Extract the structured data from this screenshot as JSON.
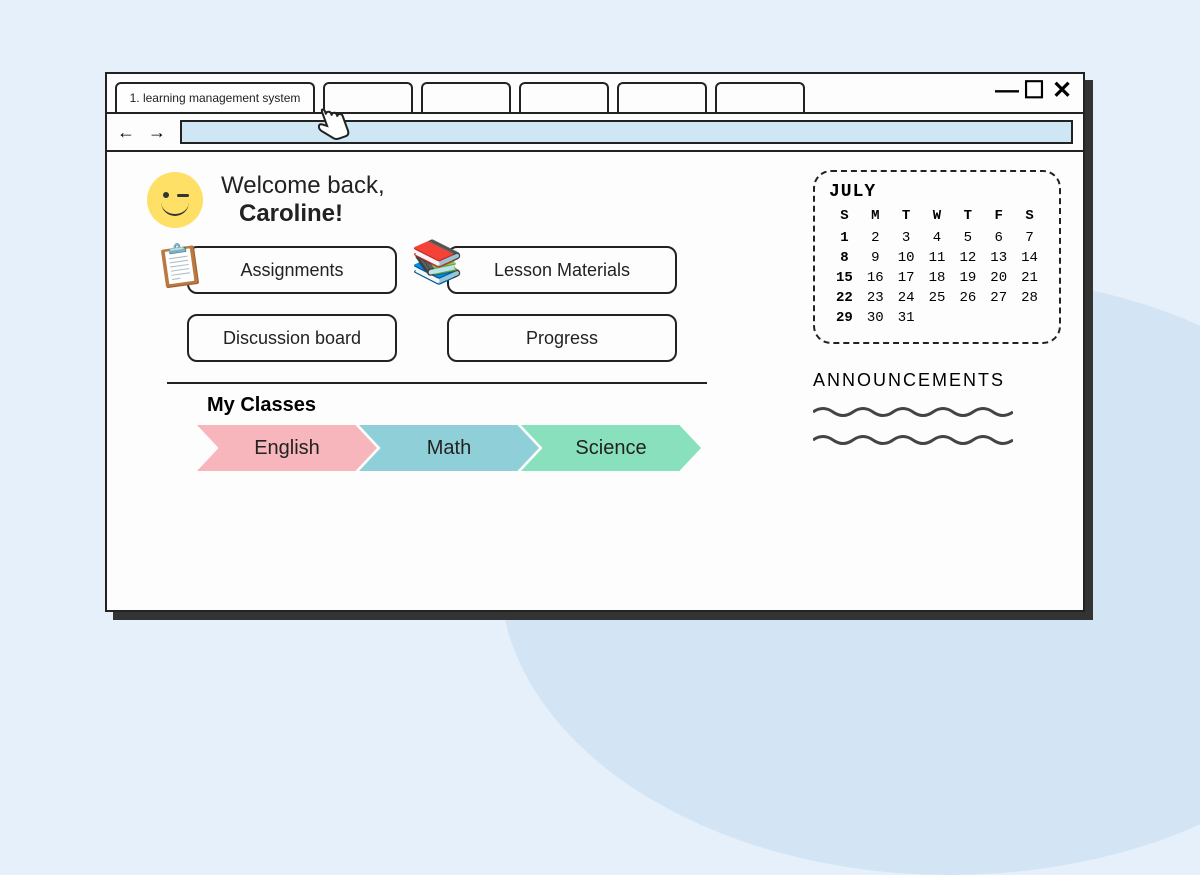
{
  "browser": {
    "tab_label": "1. learning management system",
    "nav_arrows": "← →"
  },
  "welcome": {
    "greeting": "Welcome back,",
    "name": "Caroline!"
  },
  "nav_buttons": {
    "assignments": "Assignments",
    "lesson_materials": "Lesson Materials",
    "discussion_board": "Discussion board",
    "progress": "Progress"
  },
  "classes": {
    "title": "My Classes",
    "items": [
      "English",
      "Math",
      "Science"
    ]
  },
  "calendar": {
    "month": "JULY",
    "day_headers": [
      "S",
      "M",
      "T",
      "W",
      "T",
      "F",
      "S"
    ],
    "weeks": [
      [
        "1",
        "2",
        "3",
        "4",
        "5",
        "6",
        "7"
      ],
      [
        "8",
        "9",
        "10",
        "11",
        "12",
        "13",
        "14"
      ],
      [
        "15",
        "16",
        "17",
        "18",
        "19",
        "20",
        "21"
      ],
      [
        "22",
        "23",
        "24",
        "25",
        "26",
        "27",
        "28"
      ],
      [
        "29",
        "30",
        "31",
        "",
        "",
        "",
        ""
      ]
    ],
    "bold_days": [
      "1",
      "8",
      "15",
      "22",
      "29"
    ]
  },
  "announcements": {
    "title": "ANNOUNCEMENTS"
  }
}
